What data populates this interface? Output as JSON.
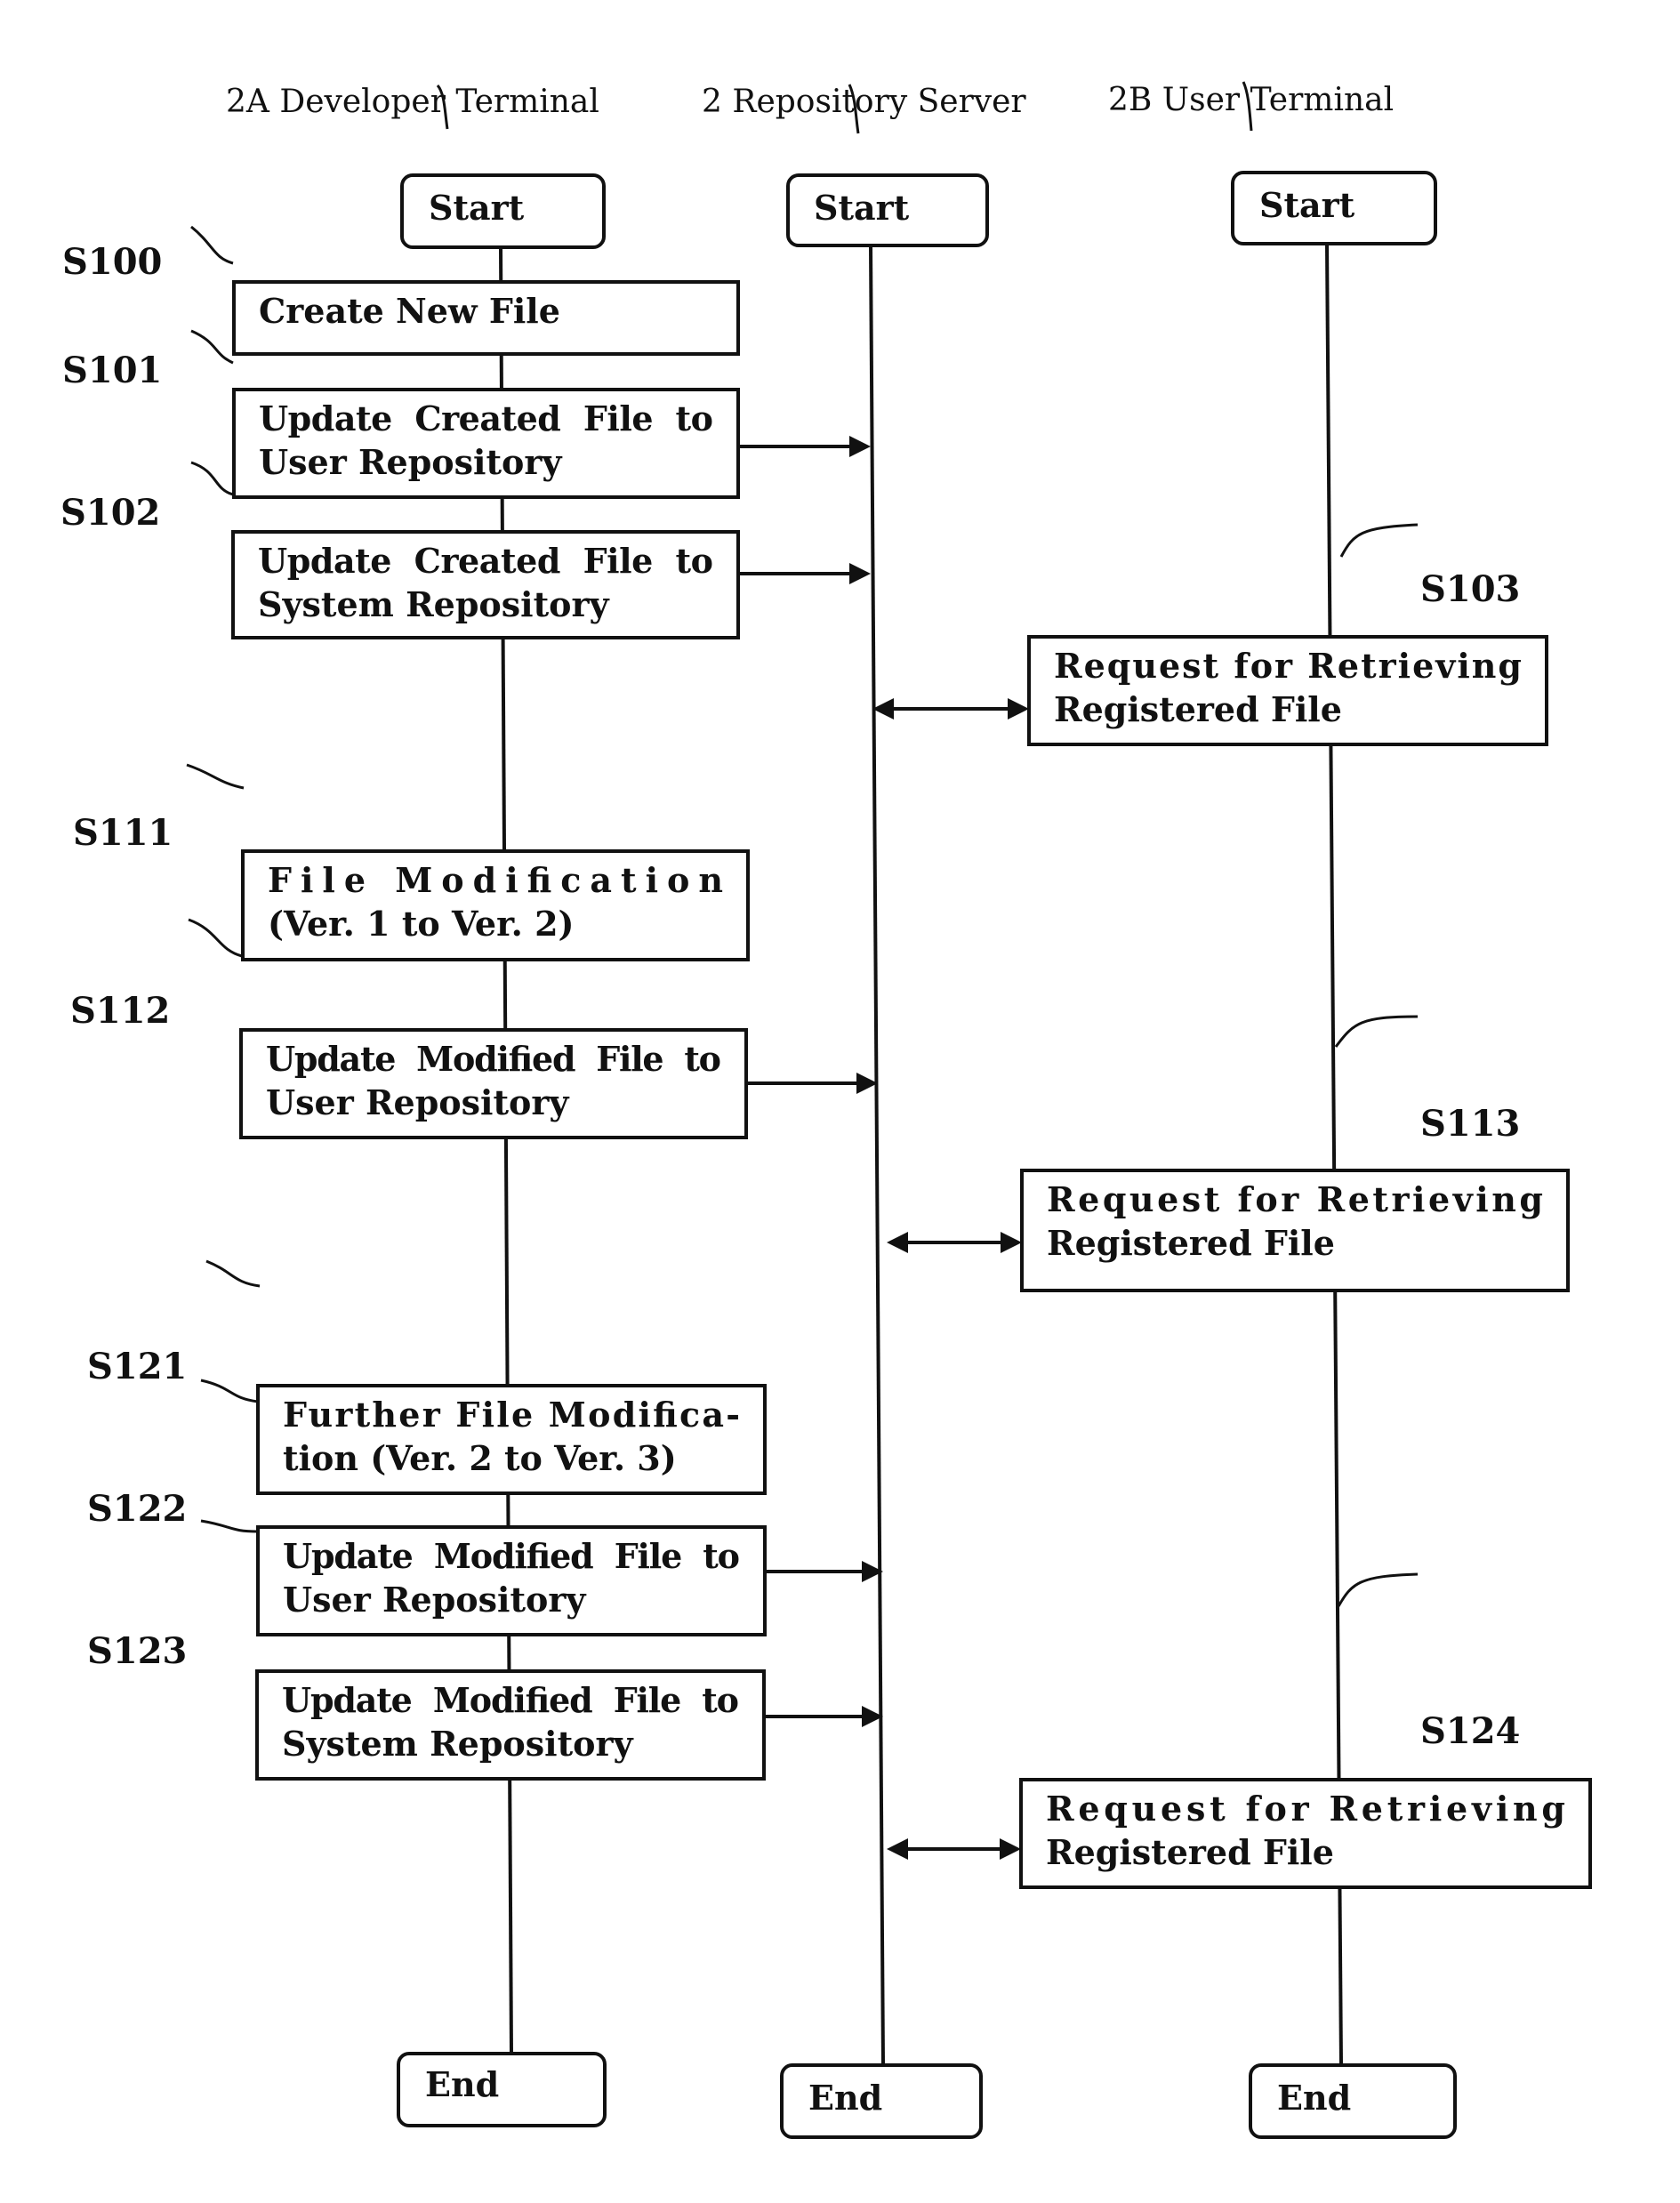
{
  "headers": {
    "developer": "2A Developer Terminal",
    "server": "2 Repository Server",
    "user": "2B User Terminal"
  },
  "terminals": {
    "start": "Start",
    "end": "End"
  },
  "developer_steps": [
    {
      "id": "S100",
      "lines": [
        "Create New File"
      ]
    },
    {
      "id": "S101",
      "lines": [
        "Update  Created  File  to",
        "User Repository"
      ]
    },
    {
      "id": "S102",
      "lines": [
        "Update  Created  File  to",
        "System Repository"
      ]
    },
    {
      "id": "S111",
      "lines": [
        "File Modification",
        "(Ver. 1 to Ver. 2)"
      ]
    },
    {
      "id": "S112",
      "lines": [
        "Update  Modified  File  to",
        "User Repository"
      ]
    },
    {
      "id": "S121",
      "lines": [
        "Further File Modifica-",
        "tion (Ver. 2 to Ver. 3)"
      ]
    },
    {
      "id": "S122",
      "lines": [
        "Update  Modified  File  to",
        "User Repository"
      ]
    },
    {
      "id": "S123",
      "lines": [
        "Update  Modified  File  to",
        "System Repository"
      ]
    }
  ],
  "user_steps": [
    {
      "id": "S103",
      "lines": [
        "Request    for    Retrieving",
        "Registered File"
      ]
    },
    {
      "id": "S113",
      "lines": [
        "Request    for    Retrieving",
        "Registered File"
      ]
    },
    {
      "id": "S124",
      "lines": [
        "Request    for    Retrieving",
        "Registered File"
      ]
    }
  ]
}
